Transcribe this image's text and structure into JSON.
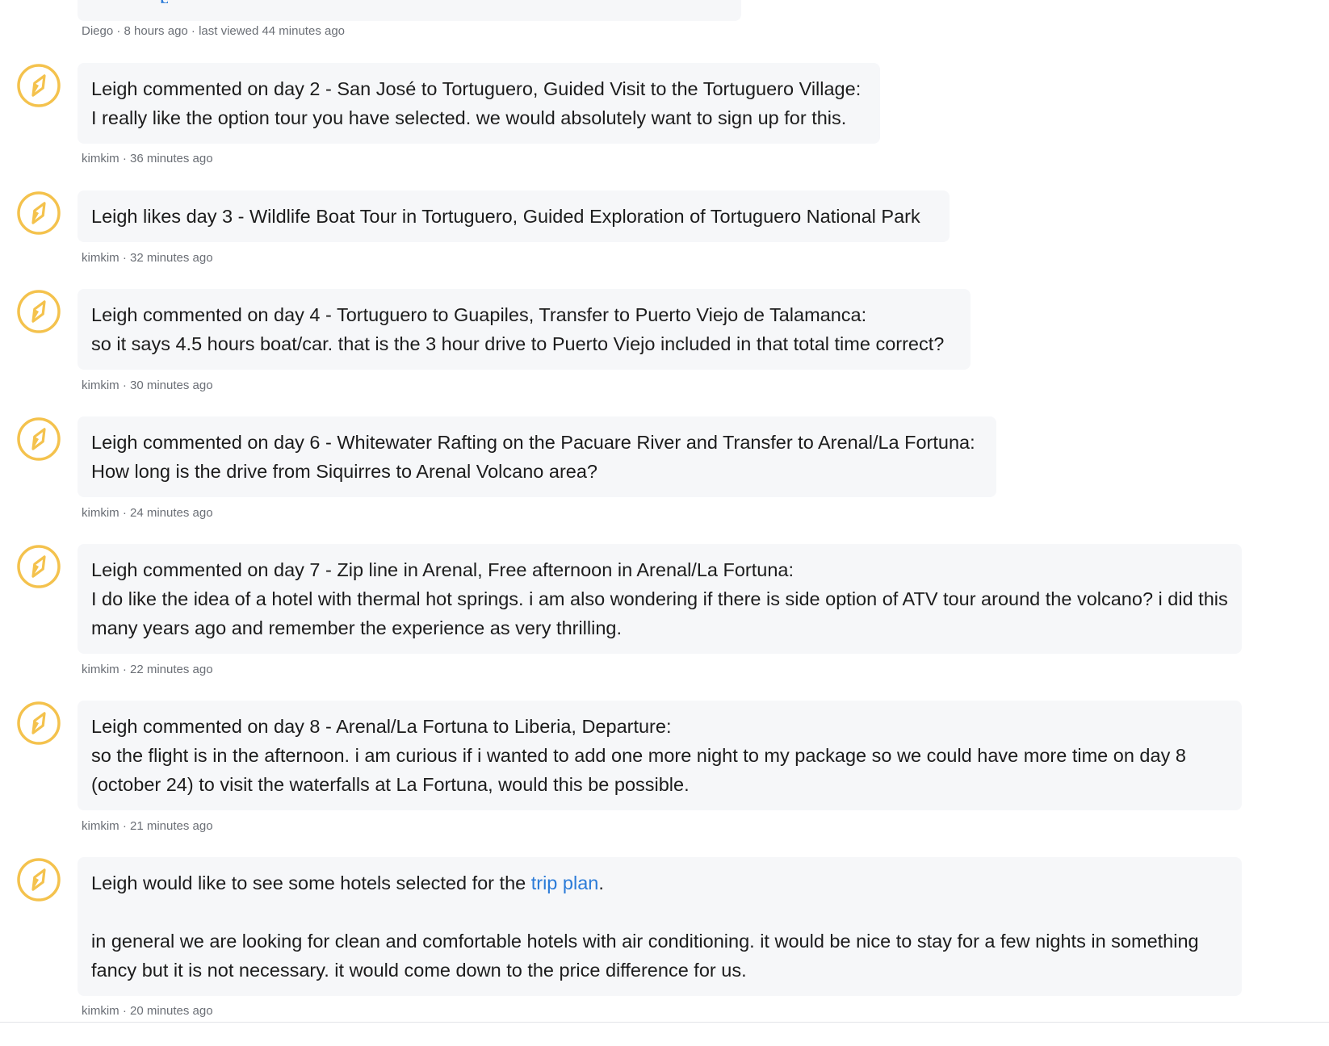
{
  "previous": {
    "meta": "Diego · 8 hours ago · last viewed 44 minutes ago"
  },
  "entries": [
    {
      "title": "Leigh commented on day 2 - San José to Tortuguero, Guided Visit to the Tortuguero Village:",
      "body": "I really like the option tour you have selected. we would absolutely want to sign up for this.",
      "meta": "kimkim · 36 minutes ago"
    },
    {
      "title": "Leigh likes day 3 - Wildlife Boat Tour in Tortuguero, Guided Exploration of Tortuguero National Park",
      "meta": "kimkim · 32 minutes ago"
    },
    {
      "title": "Leigh commented on day 4 - Tortuguero to Guapiles, Transfer to Puerto Viejo de Talamanca:",
      "body": "so it says 4.5 hours boat/car. that is the 3 hour drive to Puerto Viejo included in that total time correct?",
      "meta": "kimkim · 30 minutes ago"
    },
    {
      "title": "Leigh commented on day 6 - Whitewater Rafting on the Pacuare River and Transfer to Arenal/La Fortuna:",
      "body": "How long is the drive from Siquirres to Arenal Volcano area?",
      "meta": "kimkim · 24 minutes ago"
    },
    {
      "title": "Leigh commented on day 7 - Zip line in Arenal, Free afternoon in Arenal/La Fortuna:",
      "body": "I do like the idea of a hotel with thermal hot springs. i am also wondering if there is side option of ATV tour around the volcano? i did this many years ago and remember the experience as very thrilling.",
      "meta": "kimkim · 22 minutes ago"
    },
    {
      "title": "Leigh commented on day 8 - Arenal/La Fortuna to Liberia, Departure:",
      "body": "so the flight is in the afternoon. i am curious if i wanted to add one more night to my package so we could have more time on day 8 (october 24) to visit the waterfalls at La Fortuna, would this be possible.",
      "meta": "kimkim · 21 minutes ago"
    },
    {
      "title_before_link": "Leigh would like to see some hotels selected for the ",
      "link_text": "trip plan",
      "title_after_link": ".",
      "body": "in general we are looking for clean and comfortable hotels with air conditioning. it would be nice to stay for a few nights in something fancy but it is not necessary. it would come down to the price difference for us.",
      "meta": "kimkim · 20 minutes ago"
    }
  ],
  "avatar_icon": "compass-icon",
  "colors": {
    "accent_yellow": "#f4c24d",
    "link_blue": "#2b7bd8",
    "bubble_bg": "#f6f7f9",
    "meta_gray": "#6b6f76"
  }
}
